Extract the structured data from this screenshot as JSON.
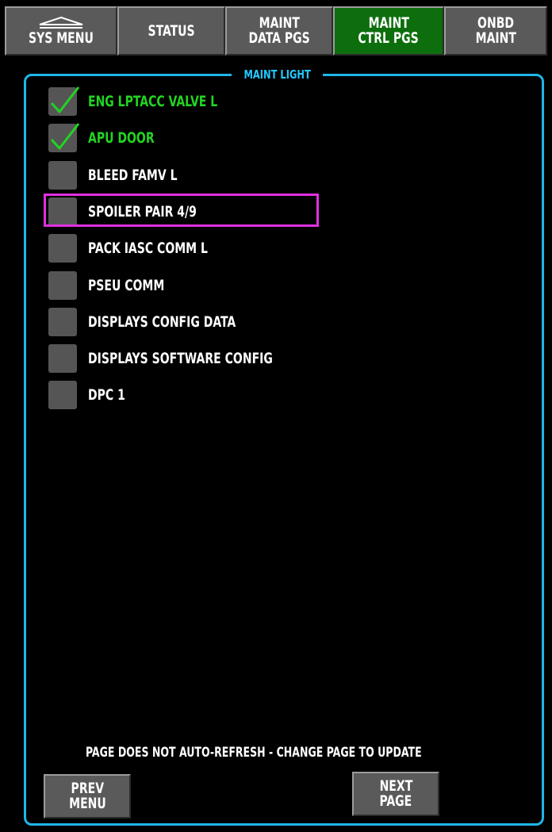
{
  "tabs": [
    {
      "lines": [
        "SYS MENU"
      ],
      "active": false,
      "icon": "eject-triangle-icon"
    },
    {
      "lines": [
        "STATUS"
      ],
      "active": false
    },
    {
      "lines": [
        "MAINT",
        "DATA PGS"
      ],
      "active": false
    },
    {
      "lines": [
        "MAINT",
        "CTRL PGS"
      ],
      "active": true
    },
    {
      "lines": [
        "ONBD",
        "MAINT"
      ],
      "active": false
    }
  ],
  "panel": {
    "title": "MAINT LIGHT"
  },
  "items": [
    {
      "label": "ENG LPTACC VALVE L",
      "checked": true,
      "selected": false
    },
    {
      "label": "APU DOOR",
      "checked": true,
      "selected": false
    },
    {
      "label": "BLEED FAMV L",
      "checked": false,
      "selected": false
    },
    {
      "label": "SPOILER PAIR 4/9",
      "checked": false,
      "selected": true
    },
    {
      "label": "PACK IASC COMM L",
      "checked": false,
      "selected": false
    },
    {
      "label": "PSEU COMM",
      "checked": false,
      "selected": false
    },
    {
      "label": "DISPLAYS CONFIG DATA",
      "checked": false,
      "selected": false
    },
    {
      "label": "DISPLAYS SOFTWARE CONFIG",
      "checked": false,
      "selected": false
    },
    {
      "label": "DPC 1",
      "checked": false,
      "selected": false
    }
  ],
  "footer": {
    "message": "PAGE DOES NOT AUTO-REFRESH - CHANGE PAGE TO UPDATE",
    "prev_button": [
      "PREV",
      "MENU"
    ],
    "next_button": [
      "NEXT",
      "PAGE"
    ]
  },
  "colors": {
    "frame": "#1fb6e8",
    "checked_text": "#22d422",
    "check_mark": "#22d422",
    "selection_box": "#e030e0",
    "active_tab": "#0d6e0d",
    "button": "#5a5a5a"
  }
}
